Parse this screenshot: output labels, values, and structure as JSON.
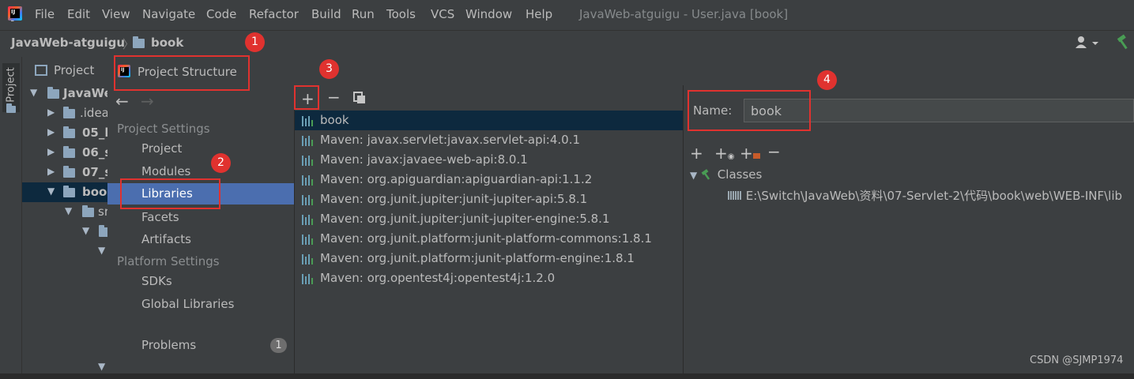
{
  "menu": {
    "items": [
      "File",
      "Edit",
      "View",
      "Navigate",
      "Code",
      "Refactor",
      "Build",
      "Run",
      "Tools",
      "VCS",
      "Window",
      "Help"
    ],
    "window_title": "JavaWeb-atguigu - User.java [book]"
  },
  "navbar": {
    "project": "JavaWeb-atguigu",
    "module": "book",
    "icons": [
      "user-icon",
      "hammer-icon"
    ]
  },
  "tool_window": {
    "side_label": "Project",
    "header": "Project",
    "tree": [
      {
        "label": "JavaWe",
        "expanded": true
      },
      {
        "label": ".idea",
        "expanded": false
      },
      {
        "label": "05_b",
        "expanded": false
      },
      {
        "label": "06_s",
        "expanded": false
      },
      {
        "label": "07_s",
        "expanded": false
      },
      {
        "label": "boo",
        "expanded": true,
        "selected": true
      },
      {
        "label": "sr",
        "expanded": true
      },
      {
        "label": "",
        "expanded": true
      },
      {
        "label": "",
        "expanded": true
      }
    ]
  },
  "dialog": {
    "title": "Project Structure",
    "sections": {
      "project_settings": "Project Settings",
      "platform_settings": "Platform Settings"
    },
    "nav_items": {
      "project": "Project",
      "modules": "Modules",
      "libraries": "Libraries",
      "facets": "Facets",
      "artifacts": "Artifacts",
      "sdks": "SDKs",
      "global_libraries": "Global Libraries",
      "problems": "Problems"
    },
    "problems_count": "1",
    "selected_nav": "Libraries",
    "libraries": [
      "book",
      "Maven: javax.servlet:javax.servlet-api:4.0.1",
      "Maven: javax:javaee-web-api:8.0.1",
      "Maven: org.apiguardian:apiguardian-api:1.1.2",
      "Maven: org.junit.jupiter:junit-jupiter-api:5.8.1",
      "Maven: org.junit.jupiter:junit-jupiter-engine:5.8.1",
      "Maven: org.junit.platform:junit-platform-commons:1.8.1",
      "Maven: org.junit.platform:junit-platform-engine:1.8.1",
      "Maven: org.opentest4j:opentest4j:1.2.0"
    ],
    "details": {
      "name_label": "Name:",
      "name_value": "book",
      "classes_label": "Classes",
      "classes_path": "E:\\Switch\\JavaWeb\\资料\\07-Servlet-2\\代码\\book\\web\\WEB-INF\\lib"
    }
  },
  "annotations": [
    "1",
    "2",
    "3",
    "4"
  ],
  "watermark": "CSDN @SJMP1974",
  "colors": {
    "accent_selection": "#4b6eaf",
    "annotation_red": "#e0322f",
    "library_icon": "#6a9fb5"
  }
}
